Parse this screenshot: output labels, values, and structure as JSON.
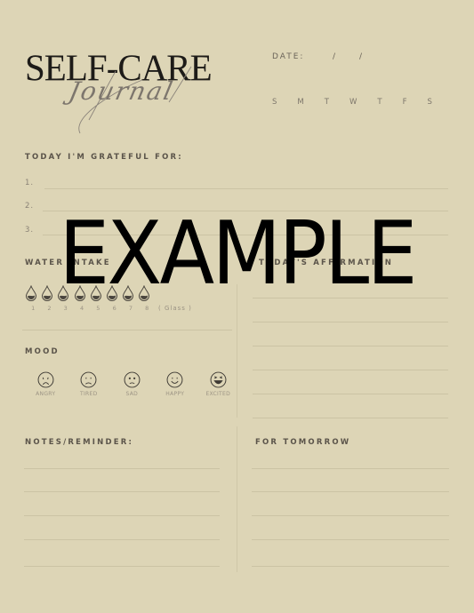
{
  "header": {
    "title_main": "SELF-CARE",
    "title_script": "Journal",
    "date_label": "DATE:",
    "date_separators": [
      "/",
      "/"
    ],
    "days": [
      "S",
      "M",
      "T",
      "W",
      "T",
      "F",
      "S"
    ]
  },
  "grateful": {
    "heading": "TODAY I'M GRATEFUL FOR:",
    "items": [
      "1.",
      "2.",
      "3."
    ]
  },
  "water": {
    "heading": "WATER INTAKE",
    "glasses": [
      "1",
      "2",
      "3",
      "4",
      "5",
      "6",
      "7",
      "8"
    ],
    "unit": "( Glass )",
    "icon": "water-drop-icon"
  },
  "affirmation": {
    "heading": "TODAY'S AFFIRMATION",
    "line_count": 6
  },
  "mood": {
    "heading": "MOOD",
    "options": [
      {
        "label": "ANGRY",
        "icon": "angry-face-icon"
      },
      {
        "label": "TIRED",
        "icon": "tired-face-icon"
      },
      {
        "label": "SAD",
        "icon": "sad-face-icon"
      },
      {
        "label": "HAPPY",
        "icon": "happy-face-icon"
      },
      {
        "label": "EXCITED",
        "icon": "excited-face-icon"
      }
    ]
  },
  "notes": {
    "heading": "NOTES/REMINDER:",
    "line_count": 5
  },
  "tomorrow": {
    "heading": "FOR TOMORROW",
    "line_count": 5
  },
  "watermark": "EXAMPLE",
  "colors": {
    "background": "#ddd5b6",
    "heading": "#5b544a",
    "rule": "#cbc3a4",
    "watermark": "#000000"
  }
}
